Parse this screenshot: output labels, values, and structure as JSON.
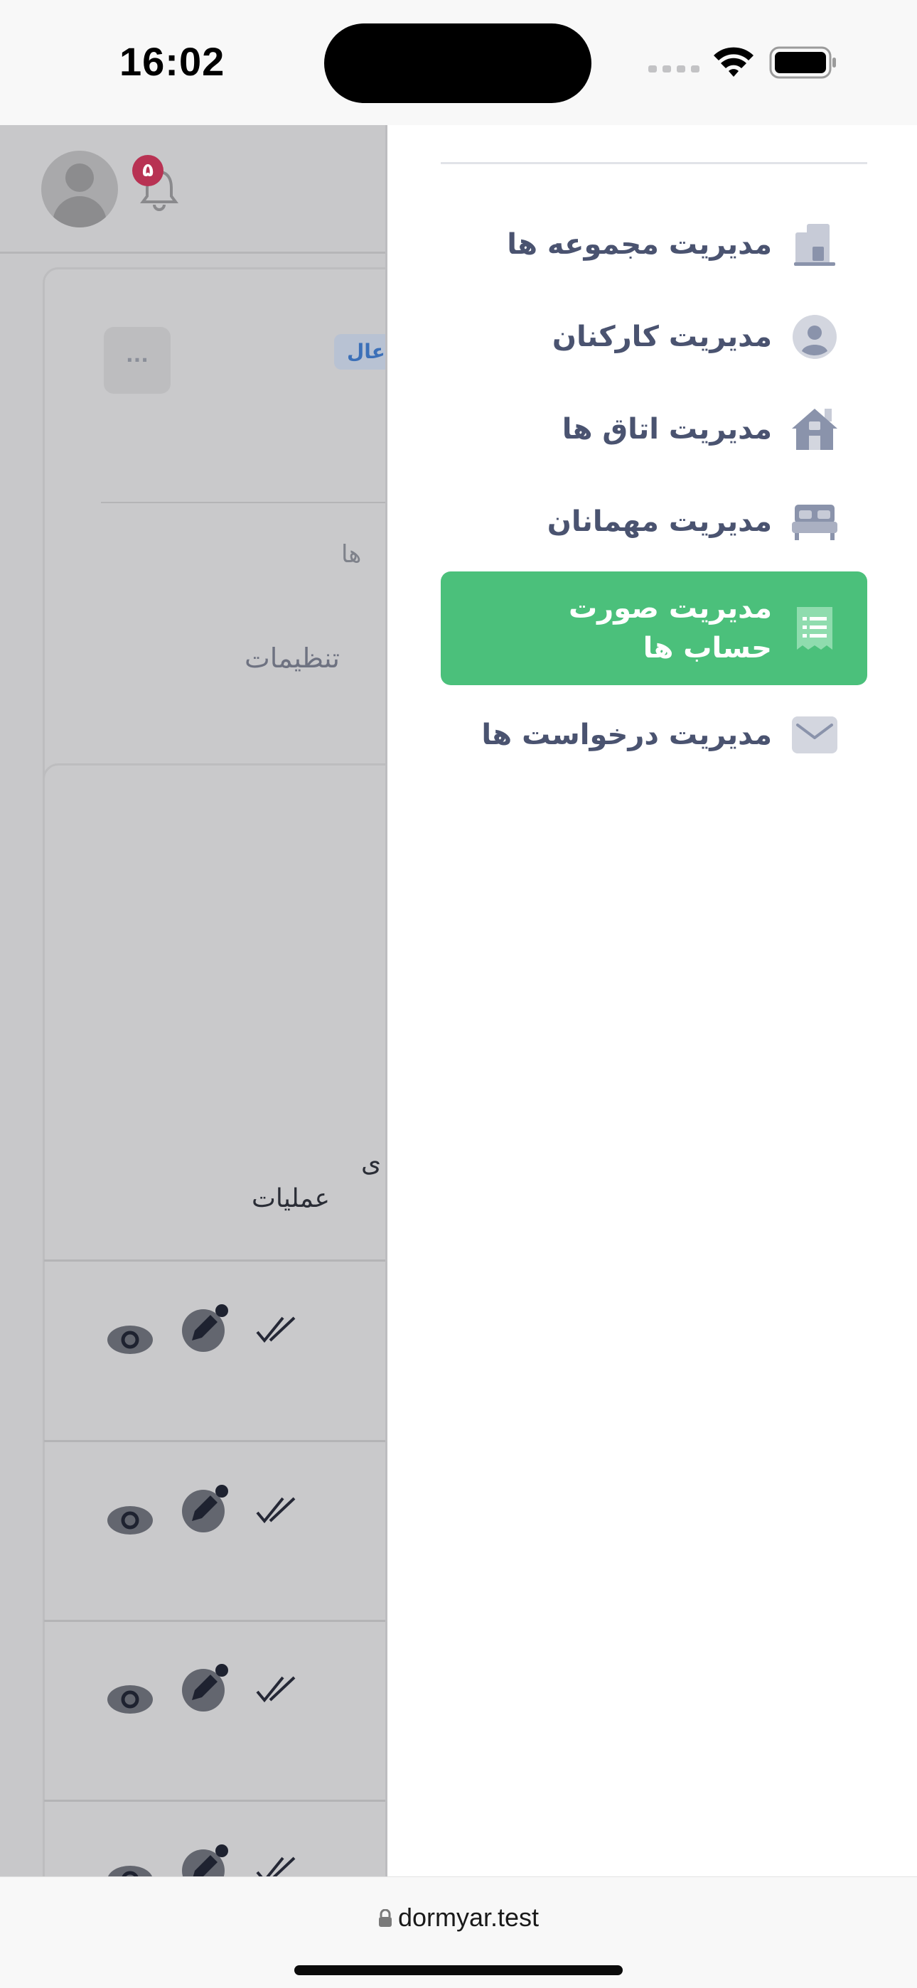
{
  "status_bar": {
    "time": "16:02"
  },
  "background_page": {
    "notification_count": "۵",
    "status_badge": "عال",
    "more_button": "···",
    "fragment_text": "ها",
    "settings_label": "تنظیمات",
    "column_fragment": "ی",
    "operations_header": "عملیات"
  },
  "drawer": {
    "items": [
      {
        "label": "مدیریت مجموعه ها",
        "icon": "building-icon"
      },
      {
        "label": "مدیریت کارکنان",
        "icon": "user-circle-icon"
      },
      {
        "label": "مدیریت اتاق ها",
        "icon": "house-icon"
      },
      {
        "label": "مدیریت مهمانان",
        "icon": "bed-icon"
      },
      {
        "label": "مدیریت صورت حساب ها",
        "icon": "receipt-icon",
        "active": true
      },
      {
        "label": "مدیریت درخواست ها",
        "icon": "envelope-icon"
      }
    ]
  },
  "browser": {
    "url": "dormyar.test",
    "lock_icon": "lock-icon"
  },
  "colors": {
    "accent": "#4bc07b",
    "menu_text": "#4a5370",
    "icon": "#9aa1b5",
    "badge": "#d8355a"
  }
}
